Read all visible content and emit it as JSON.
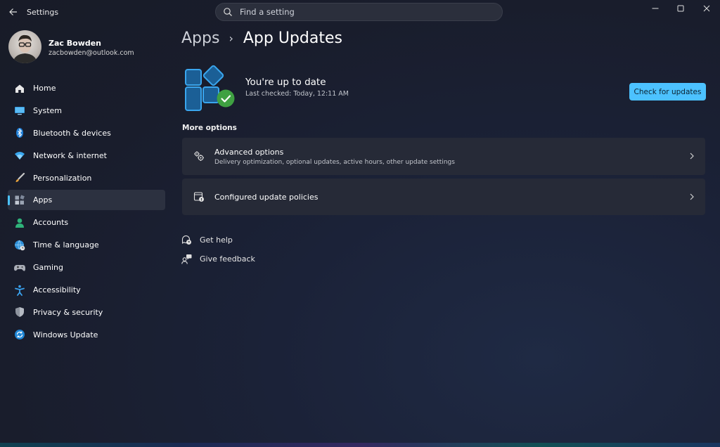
{
  "window": {
    "title": "Settings"
  },
  "search": {
    "placeholder": "Find a setting"
  },
  "user": {
    "name": "Zac Bowden",
    "email": "zacbowden@outlook.com"
  },
  "nav": {
    "items": [
      {
        "label": "Home",
        "icon": "home-icon",
        "active": false
      },
      {
        "label": "System",
        "icon": "system-icon",
        "active": false
      },
      {
        "label": "Bluetooth & devices",
        "icon": "bluetooth-icon",
        "active": false
      },
      {
        "label": "Network & internet",
        "icon": "wifi-icon",
        "active": false
      },
      {
        "label": "Personalization",
        "icon": "brush-icon",
        "active": false
      },
      {
        "label": "Apps",
        "icon": "apps-icon",
        "active": true
      },
      {
        "label": "Accounts",
        "icon": "person-icon",
        "active": false
      },
      {
        "label": "Time & language",
        "icon": "globe-clock-icon",
        "active": false
      },
      {
        "label": "Gaming",
        "icon": "gamepad-icon",
        "active": false
      },
      {
        "label": "Accessibility",
        "icon": "accessibility-icon",
        "active": false
      },
      {
        "label": "Privacy & security",
        "icon": "shield-icon",
        "active": false
      },
      {
        "label": "Windows Update",
        "icon": "update-icon",
        "active": false
      }
    ]
  },
  "breadcrumb": {
    "parent": "Apps",
    "separator": "›",
    "current": "App Updates"
  },
  "status": {
    "title": "You're up to date",
    "subtitle": "Last checked: Today, 12:11 AM",
    "button": "Check for updates"
  },
  "more_options": {
    "title": "More options",
    "cards": [
      {
        "title": "Advanced options",
        "subtitle": "Delivery optimization, optional updates, active hours, other update settings",
        "icon": "gears-icon"
      },
      {
        "title": "Configured update policies",
        "icon": "policy-icon"
      }
    ]
  },
  "links": [
    {
      "label": "Get help",
      "icon": "help-chat-icon"
    },
    {
      "label": "Give feedback",
      "icon": "feedback-icon"
    }
  ],
  "colors": {
    "accent": "#4cc2ff",
    "success": "#3fa142",
    "card": "#262a37"
  }
}
